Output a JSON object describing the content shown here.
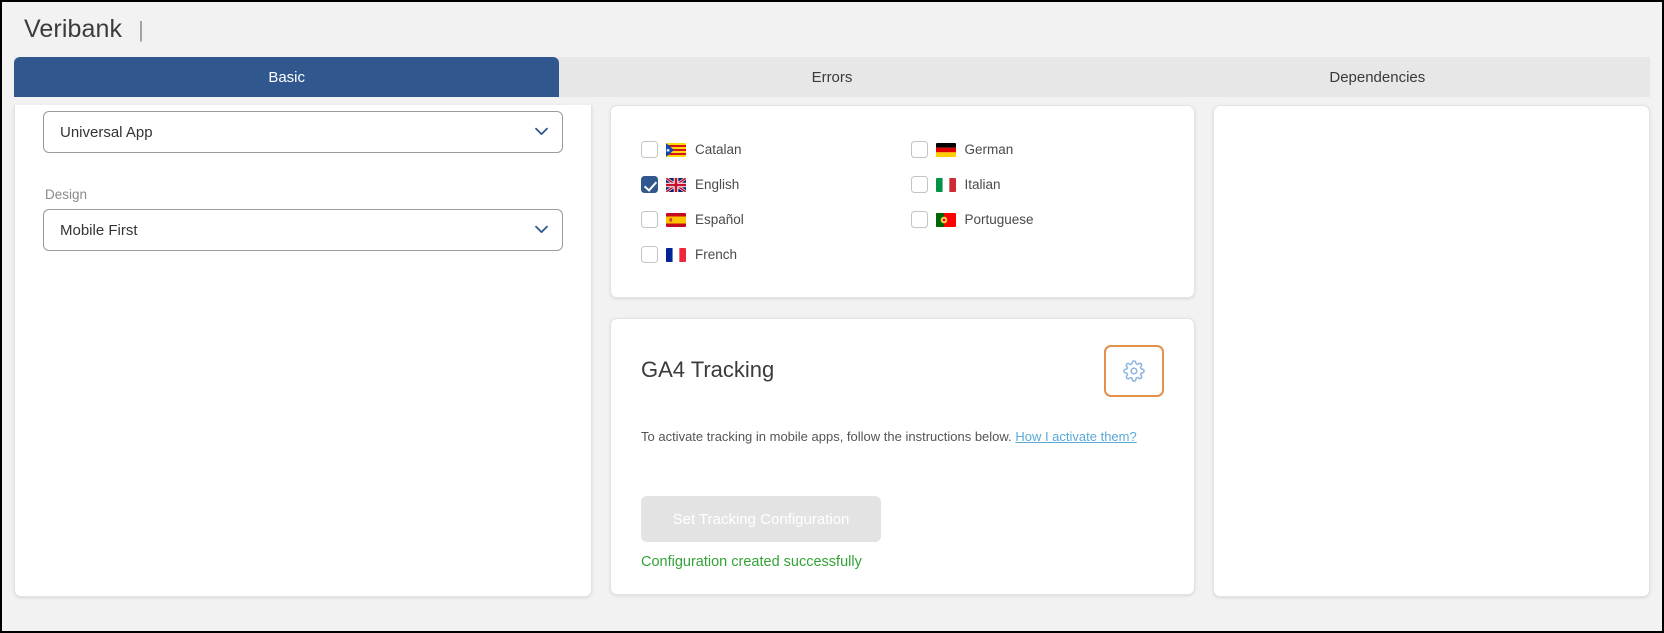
{
  "header": {
    "app_title": "Veribank",
    "title_separator": "|"
  },
  "tabs": [
    {
      "label": "Basic",
      "active": true
    },
    {
      "label": "Errors",
      "active": false
    },
    {
      "label": "Dependencies",
      "active": false
    }
  ],
  "left_panel": {
    "app_type_select": {
      "value": "Universal App"
    },
    "design": {
      "label": "Design",
      "value": "Mobile First"
    }
  },
  "languages_card": {
    "items": [
      {
        "name": "Catalan",
        "checked": false,
        "flag": "catalan-flag-icon"
      },
      {
        "name": "German",
        "checked": false,
        "flag": "german-flag-icon"
      },
      {
        "name": "English",
        "checked": true,
        "flag": "uk-flag-icon"
      },
      {
        "name": "Italian",
        "checked": false,
        "flag": "italian-flag-icon"
      },
      {
        "name": "Español",
        "checked": false,
        "flag": "spanish-flag-icon"
      },
      {
        "name": "Portuguese",
        "checked": false,
        "flag": "portuguese-flag-icon"
      },
      {
        "name": "French",
        "checked": false,
        "flag": "french-flag-icon"
      }
    ]
  },
  "ga4_card": {
    "title": "GA4 Tracking",
    "settings_icon": "gear-icon",
    "description_prefix": "To activate tracking in mobile apps, follow the instructions below.",
    "help_link": "How I activate them?",
    "button_label": "Set Tracking Configuration",
    "status_message": "Configuration created successfully"
  },
  "colors": {
    "accent_blue": "#31578f",
    "focus_orange": "#e2914a",
    "success_green": "#34a337",
    "link_blue": "#5aa9d6",
    "page_bg": "#f2f2f2",
    "tab_inactive_bg": "#e7e7e7"
  }
}
